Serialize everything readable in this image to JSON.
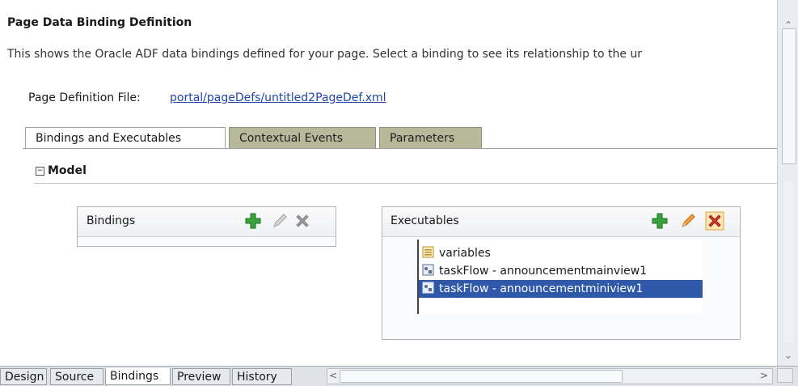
{
  "header": {
    "title": "Page Data Binding Definition",
    "description": "This shows the Oracle ADF data bindings defined for your page. Select a binding to see its relationship to the ur"
  },
  "page_definition": {
    "label": "Page Definition File:",
    "file_link": "portal/pageDefs/untitled2PageDef.xml"
  },
  "tabs": [
    {
      "label": "Bindings and Executables",
      "active": true
    },
    {
      "label": "Contextual Events",
      "active": false
    },
    {
      "label": "Parameters",
      "active": false
    }
  ],
  "model": {
    "toggle": "−",
    "label": "Model"
  },
  "bindings_panel": {
    "label": "Bindings"
  },
  "executables_panel": {
    "label": "Executables",
    "items": [
      {
        "label": "variables",
        "icon": "variables-icon",
        "selected": false
      },
      {
        "label": "taskFlow - announcementmainview1",
        "icon": "taskflow-icon",
        "selected": false
      },
      {
        "label": "taskFlow - announcementminiview1",
        "icon": "taskflow-icon",
        "selected": true
      }
    ]
  },
  "bottom_tabs": [
    {
      "label": "Design",
      "active": false
    },
    {
      "label": "Source",
      "active": false
    },
    {
      "label": "Bindings",
      "active": true
    },
    {
      "label": "Preview",
      "active": false
    },
    {
      "label": "History",
      "active": false
    }
  ],
  "colors": {
    "link": "#1f46a8",
    "selection": "#2f59a8",
    "inactive_tab": "#b8b89b",
    "add_icon": "#3aa23a",
    "delete_icon": "#d03a2a"
  }
}
